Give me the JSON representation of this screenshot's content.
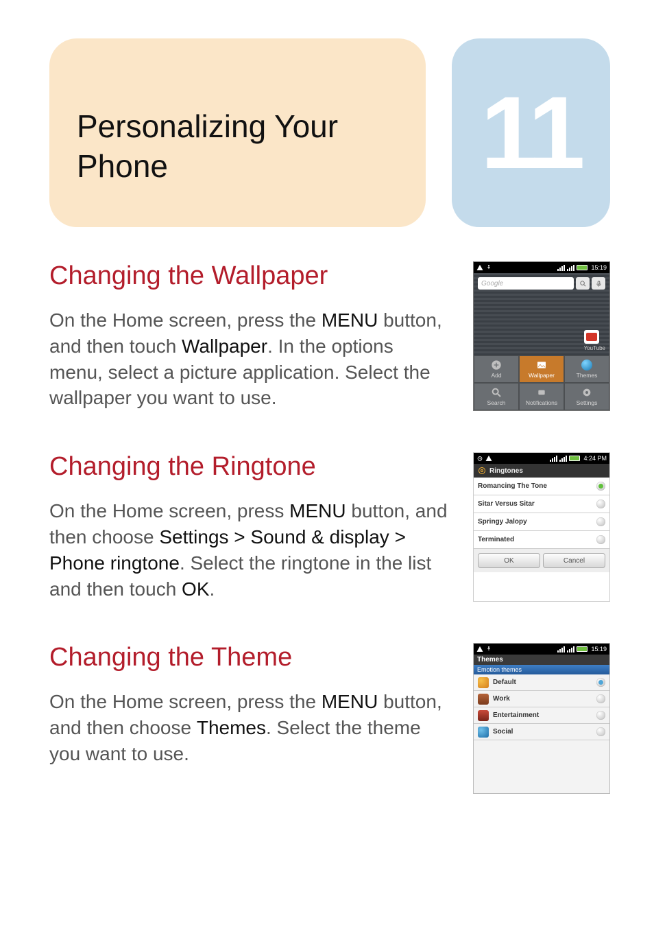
{
  "chapter": {
    "title": "Personalizing Your Phone",
    "number": "11"
  },
  "sections": {
    "wallpaper": {
      "heading": "Changing the Wallpaper",
      "p_pre": "On the Home screen, press the ",
      "p_b1": "MENU",
      "p_mid": " button, and then touch ",
      "p_b2": "Wallpaper",
      "p_post": ". In the options menu, select a picture application. Select the wallpaper you want to use."
    },
    "ringtone": {
      "heading": "Changing the Ringtone",
      "p_pre": "On the Home screen, press ",
      "p_b1": "MENU",
      "p_mid": " button, and then choose ",
      "p_b2": "Settings > Sound & display > Phone ringtone",
      "p_mid2": ". Select the ringtone in the list and then touch ",
      "p_b3": "OK",
      "p_post": "."
    },
    "theme": {
      "heading": "Changing the Theme",
      "p_pre": "On the Home screen, press the ",
      "p_b1": "MENU",
      "p_mid": " button, and then choose ",
      "p_b2": "Themes",
      "p_post": ". Select the theme you want to use."
    }
  },
  "phone1": {
    "time": "15:19",
    "search_placeholder": "Google",
    "youtube_label": "YouTube",
    "menu": {
      "add": "Add",
      "wallpaper": "Wallpaper",
      "themes": "Themes",
      "search": "Search",
      "notifications": "Notifications",
      "settings": "Settings"
    }
  },
  "phone2": {
    "time": "4:24 PM",
    "header": "Ringtones",
    "items": [
      "Romancing The Tone",
      "Sitar Versus Sitar",
      "Springy Jalopy",
      "Terminated"
    ],
    "ok": "OK",
    "cancel": "Cancel"
  },
  "phone3": {
    "time": "15:19",
    "title": "Themes",
    "subtitle": "Emotion themes",
    "items": [
      "Default",
      "Work",
      "Entertainment",
      "Social"
    ]
  }
}
